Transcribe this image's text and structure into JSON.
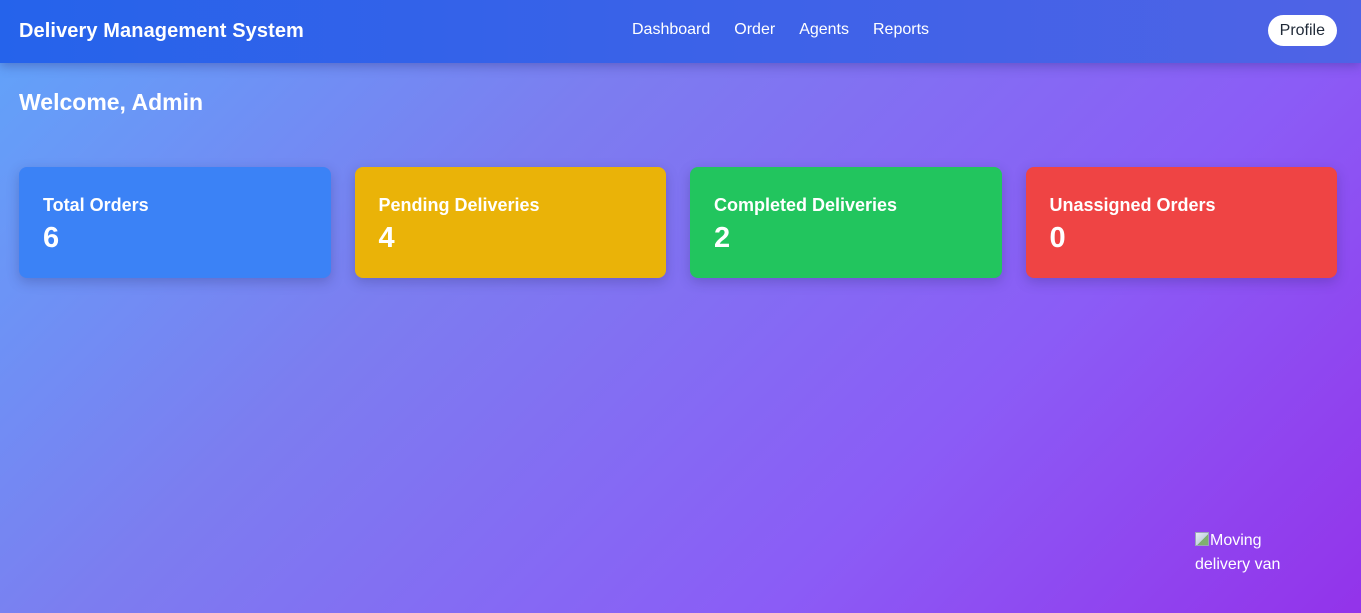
{
  "header": {
    "brand": "Delivery Management System",
    "nav": [
      "Dashboard",
      "Order",
      "Agents",
      "Reports"
    ],
    "profile_label": "Profile"
  },
  "welcome": "Welcome, Admin",
  "stats": [
    {
      "label": "Total Orders",
      "value": "6",
      "color": "#3b82f6"
    },
    {
      "label": "Pending Deliveries",
      "value": "4",
      "color": "#eab308"
    },
    {
      "label": "Completed Deliveries",
      "value": "2",
      "color": "#22c55e"
    },
    {
      "label": "Unassigned Orders",
      "value": "0",
      "color": "#ef4444"
    }
  ],
  "van_image": {
    "alt_text": "Moving delivery van",
    "icon": "broken-image-icon"
  },
  "colors": {
    "navbar": "#2f62e9",
    "background_start": "#60a5fa",
    "background_end": "#9333ea"
  }
}
